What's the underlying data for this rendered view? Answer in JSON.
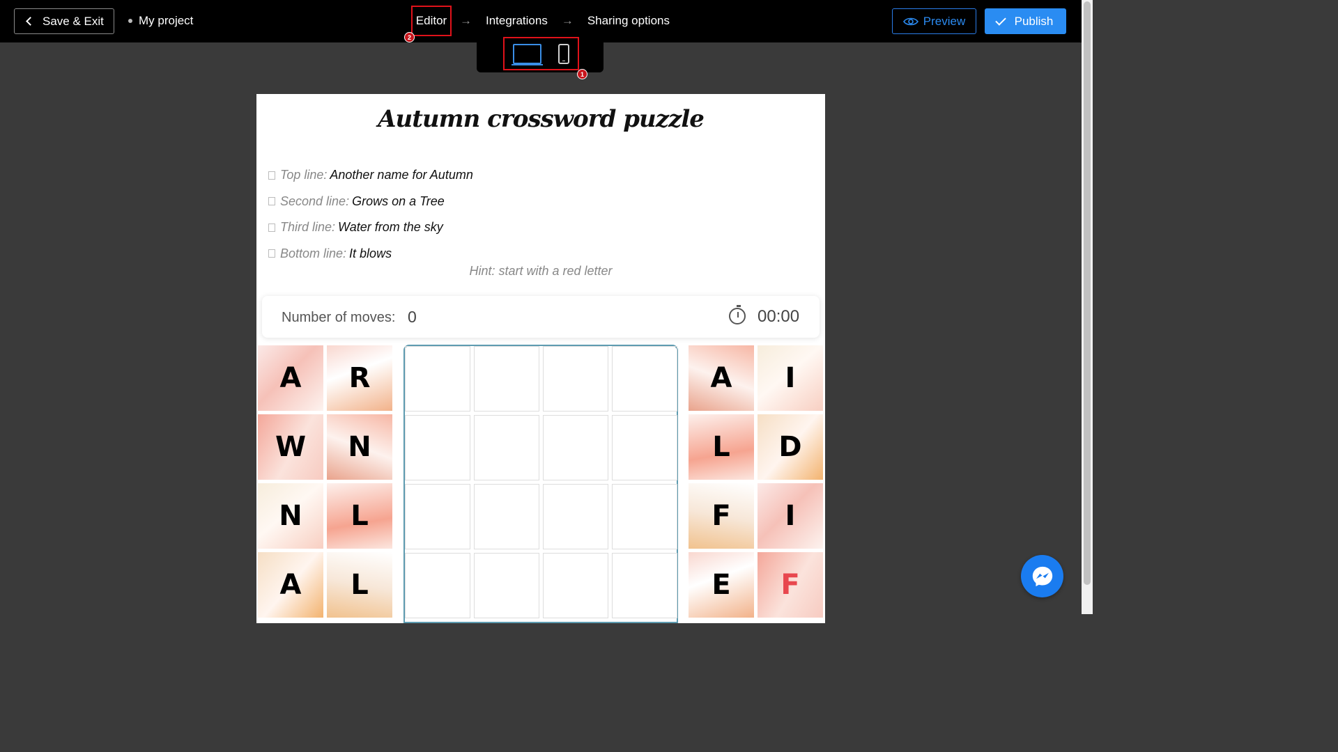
{
  "topbar": {
    "save_exit": "Save & Exit",
    "project_name": "My project",
    "steps": [
      "Editor",
      "Integrations",
      "Sharing options"
    ],
    "step_arrow": "→",
    "preview": "Preview",
    "publish": "Publish"
  },
  "badges": {
    "editor": "2",
    "devices": "1"
  },
  "devices": {
    "active": "desktop",
    "options": [
      "desktop",
      "mobile"
    ]
  },
  "puzzle": {
    "title": "Autumn crossword puzzle",
    "clues": [
      {
        "label": "Top line:",
        "answer": "Another name for Autumn"
      },
      {
        "label": "Second line:",
        "answer": "Grows on a Tree"
      },
      {
        "label": "Third line:",
        "answer": "Water from the sky"
      },
      {
        "label": "Bottom line:",
        "answer": "It blows"
      }
    ],
    "hint": "Hint: start with a red letter",
    "moves_label": "Number of moves:",
    "moves_value": "0",
    "timer": "00:00"
  },
  "tiles_left": [
    "A",
    "R",
    "W",
    "N",
    "N",
    "L",
    "A",
    "L"
  ],
  "tiles_right": [
    "A",
    "I",
    "L",
    "D",
    "F",
    "I",
    "E",
    "F"
  ],
  "highlight_tile": "F",
  "colors": {
    "accent": "#2a8cf2",
    "highlight": "#e0121a",
    "red_letter": "#e8474e",
    "grid_border": "#5d9bb0"
  }
}
